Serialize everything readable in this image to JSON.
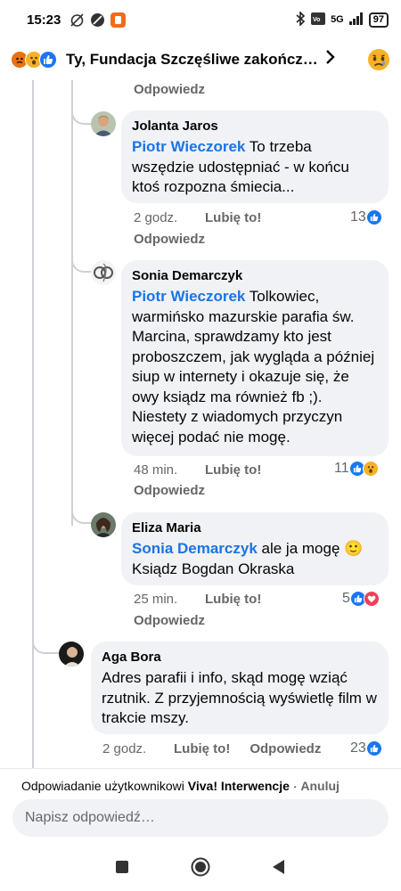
{
  "status": {
    "time": "15:23",
    "battery": "97",
    "net": "5G"
  },
  "header": {
    "title": "Ty, Fundacja Szczęśliwe zakończen..."
  },
  "top_reply_label": "Odpowiedz",
  "comments": [
    {
      "author": "Jolanta Jaros",
      "mention": "Piotr Wieczorek",
      "text": " To trzeba wszędzie udostępniać - w końcu ktoś rozpozna śmiecia...",
      "time": "2 godz.",
      "like": "Lubię to!",
      "reply": "Odpowiedz",
      "count": "13"
    },
    {
      "author": "Sonia Demarczyk",
      "mention": "Piotr Wieczorek",
      "text": " Tolkowiec, warmińsko mazurskie parafia św. Marcina, sprawdzamy kto jest proboszczem, jak wygląda a później siup w internety i okazuje się, że owy ksiądz ma również fb ;). Niestety z wiadomych przyczyn więcej podać nie mogę.",
      "time": "48 min.",
      "like": "Lubię to!",
      "reply": "Odpowiedz",
      "count": "11"
    },
    {
      "author": "Eliza Maria",
      "mention": "Sonia Demarczyk",
      "text": " ale ja mogę 🙂 Ksiądz Bogdan Okraska",
      "time": "25 min.",
      "like": "Lubię to!",
      "reply": "Odpowiedz",
      "count": "5"
    },
    {
      "author": "Aga Bora",
      "text": "Adres parafii i info, skąd mogę wziąć rzutnik. Z przyjemnością wyświetlę film w trakcie mszy.",
      "time": "2 godz.",
      "like": "Lubię to!",
      "reply": "Odpowiedz",
      "count": "23"
    }
  ],
  "reply_bar": {
    "prefix": "Odpowiadanie użytkownikowi ",
    "target": "Viva! Interwencje",
    "separator": " · ",
    "cancel": "Anuluj",
    "placeholder": "Napisz odpowiedź…"
  },
  "colors": {
    "link": "#1b74e4",
    "bubble": "#f0f2f5",
    "meta": "#65676b",
    "like": "#1877f2"
  }
}
